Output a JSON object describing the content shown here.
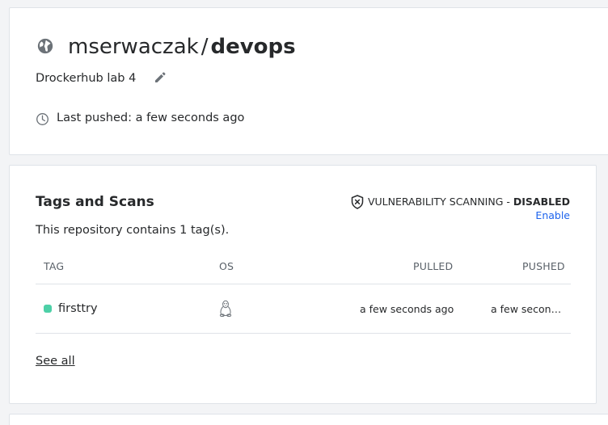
{
  "repo": {
    "namespace": "mserwaczak",
    "separator": "/",
    "name": "devops",
    "description": "Drockerhub lab 4",
    "last_pushed": "Last pushed: a few seconds ago",
    "visibility_icon": "globe-icon",
    "edit_icon": "pencil-icon",
    "clock_icon": "clock-icon"
  },
  "tags_section": {
    "title": "Tags and Scans",
    "summary": "This repository contains 1 tag(s).",
    "vulnerability_label": "VULNERABILITY SCANNING - ",
    "vulnerability_status": "DISABLED",
    "enable_label": "Enable",
    "columns": [
      "TAG",
      "OS",
      "PULLED",
      "PUSHED"
    ],
    "rows": [
      {
        "tag": "firsttry",
        "os_icon": "linux-icon",
        "pulled": "a few seconds ago",
        "pushed": "a few seconds ago",
        "status_color": "#4dd0a7"
      }
    ],
    "see_all_label": "See all"
  },
  "colors": {
    "accent_link": "#1d63ed",
    "text": "#27292b",
    "muted": "#5a6169",
    "border": "#dfe3e8",
    "background": "#f3f4f6"
  }
}
